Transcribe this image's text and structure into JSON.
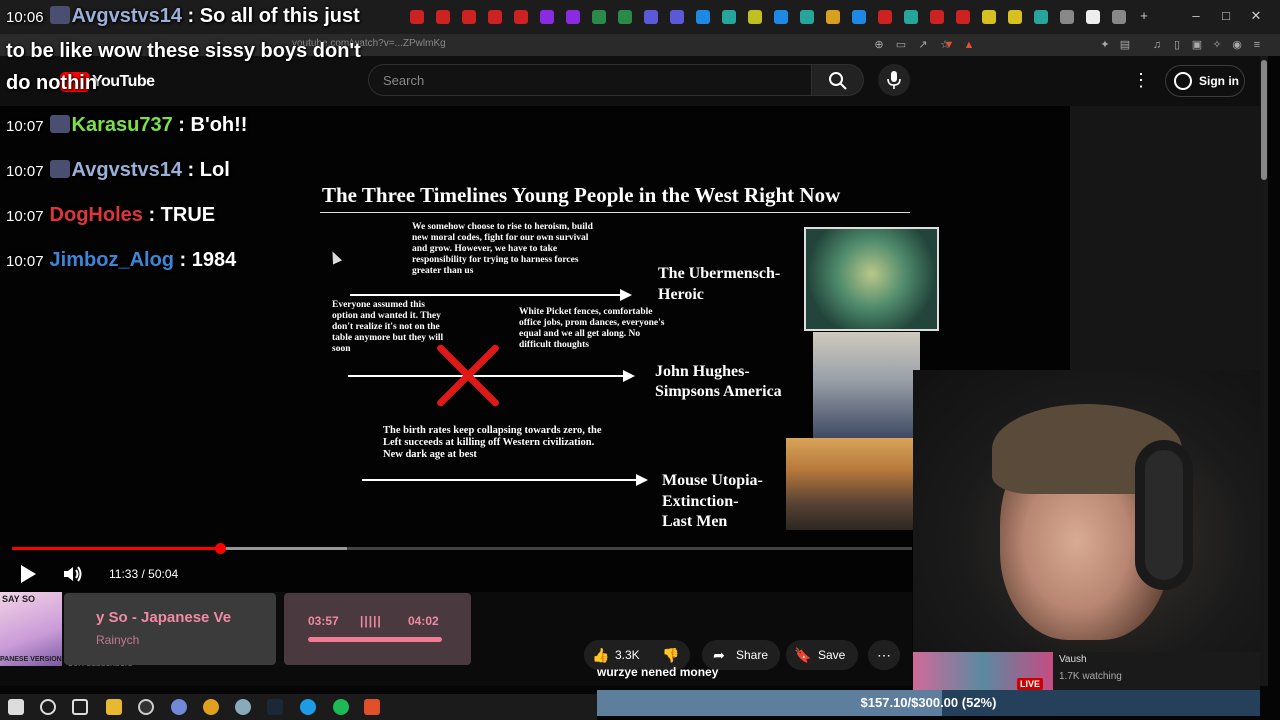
{
  "browser": {
    "url": "youtube.com/watch?v=...ZPwlmKg",
    "window_controls": [
      "–",
      "□",
      "✕"
    ]
  },
  "youtube": {
    "logo_text": "YouTube",
    "search_placeholder": "Search",
    "signin_label": "Sign in"
  },
  "chat": {
    "first_message": {
      "time": "10:06",
      "user": "Avgvstvs14",
      "text": "So all of this just"
    },
    "first_message_cont": [
      "to be like wow these sissy boys don't",
      "do nothin"
    ],
    "messages": [
      {
        "time": "10:07",
        "user": "Karasu737",
        "text": "B'oh!!",
        "color": "#7be04a"
      },
      {
        "time": "10:07",
        "user": "Avgvstvs14",
        "text": "Lol",
        "color": "#9ab0d8"
      },
      {
        "time": "10:07",
        "user": "DogHoles",
        "text": "TRUE",
        "color": "#e0343c"
      },
      {
        "time": "10:07",
        "user": "Jimboz_Alog",
        "text": "1984",
        "color": "#3c86d8"
      }
    ]
  },
  "slide": {
    "title": "The Three Timelines Young People in the West Right Now",
    "top_text": "We somehow choose to rise to heroism, build new moral codes, fight for our own survival and grow. However, we have to take responsibility for trying to harness forces greater than us",
    "top_label_1": "The Ubermensch-",
    "top_label_2": "Heroic",
    "left_text": "Everyone assumed this option and wanted it. They don't realize it's not on the table anymore but they will soon",
    "mid_text": "White Picket fences, comfortable office jobs, prom dances, everyone's equal and we all get along. No difficult thoughts",
    "mid_label_1": "John Hughes-",
    "mid_label_2": "Simpsons America",
    "bottom_text": "The birth rates keep collapsing towards zero, the Left succeeds at killing off Western civilization. New dark age at best",
    "bottom_label_1": "Mouse Utopia-",
    "bottom_label_2": "Extinction-",
    "bottom_label_3": "Last Men"
  },
  "player": {
    "time": "11:33 / 50:04",
    "progress_fraction": 0.231,
    "buffer_fraction": 0.372
  },
  "now_playing": {
    "thumb_top": "SAY SO",
    "thumb_bottom": "PANESE VERSION",
    "title": "y So - Japanese Ve",
    "artist": "Rainych",
    "current": "03:57",
    "bars": "|||||",
    "total": "04:02"
  },
  "subscribers": "30K subscribers",
  "actions": {
    "likes": "3.3K",
    "share": "Share",
    "save": "Save"
  },
  "subtitle": "wurzye nened money",
  "live": {
    "badge": "LIVE",
    "channel": "Vaush",
    "watching": "1.7K watching"
  },
  "donation": {
    "text": "$157.10/$300.00 (52%)",
    "fraction": 0.52
  },
  "colors": {
    "youtube_red": "#ff0000",
    "chat_user_first": "#9ab0d8"
  }
}
